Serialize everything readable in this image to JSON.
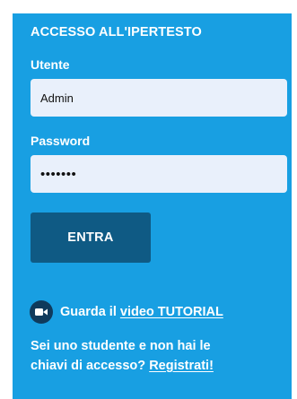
{
  "login": {
    "title": "ACCESSO ALL'IPERTESTO",
    "username_label": "Utente",
    "username_value": "Admin",
    "password_label": "Password",
    "password_value": "•••••••",
    "submit_label": "ENTRA"
  },
  "tutorial": {
    "text": "Guarda il",
    "link_label": "video TUTORIAL",
    "icon": "video-camera-icon"
  },
  "signup": {
    "line1": "Sei uno studente e non hai le",
    "line2": "chiavi di accesso?",
    "link_label": "Registrati!"
  },
  "colors": {
    "panel_bg": "#189fe2",
    "button_bg": "#0f5a84",
    "input_bg": "#e9f0fb",
    "icon_bg": "#0f3a5c"
  }
}
